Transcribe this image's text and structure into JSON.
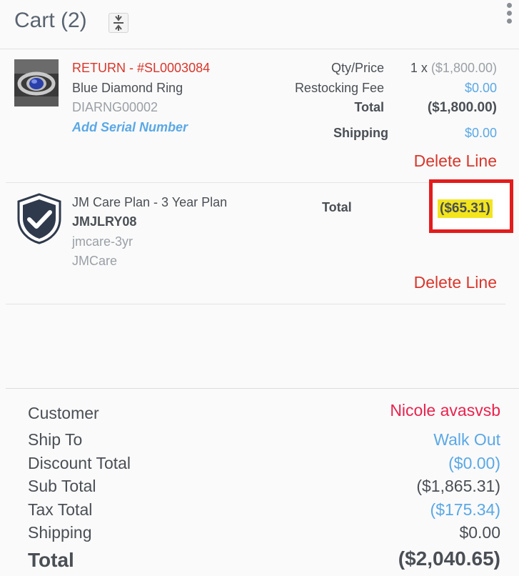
{
  "header": {
    "title": "Cart (2)"
  },
  "lines": [
    {
      "return_label": "RETURN - #SL0003084",
      "name": "Blue Diamond Ring",
      "sku": "DIARNG00002",
      "serial_link": "Add Serial Number",
      "qty_price_label": "Qty/Price",
      "qty_prefix": "1 x",
      "unit_price": "($1,800.00)",
      "restocking_label": "Restocking Fee",
      "restocking_value": "$0.00",
      "total_label": "Total",
      "total_value": "($1,800.00)",
      "shipping_label": "Shipping",
      "shipping_value": "$0.00",
      "delete_label": "Delete Line"
    },
    {
      "name": "JM Care Plan - 3 Year Plan",
      "sku": "JMJLRY08",
      "code": "jmcare-3yr",
      "vendor": "JMCare",
      "total_label": "Total",
      "total_value": "($65.31)",
      "delete_label": "Delete Line"
    }
  ],
  "summary": {
    "customer_label": "Customer",
    "customer_value": "Nicole avasvsb",
    "ship_to_label": "Ship To",
    "ship_to_value": "Walk Out",
    "discount_label": "Discount Total",
    "discount_value": "($0.00)",
    "subtotal_label": "Sub Total",
    "subtotal_value": "($1,865.31)",
    "tax_label": "Tax Total",
    "tax_value": "($175.34)",
    "shipping_label": "Shipping",
    "shipping_value": "$0.00",
    "total_label": "Total",
    "total_value": "($2,040.65)"
  },
  "icons": {
    "collapse": "collapse-vertical-icon",
    "menu": "kebab-menu-icon",
    "care_plan": "shield-check-icon"
  },
  "colors": {
    "return_red": "#d9362b",
    "link_blue": "#5aa8e6",
    "customer_pink": "#e8234e",
    "highlight_yellow": "#f2e51c",
    "annotation_red": "#e31c1c"
  }
}
